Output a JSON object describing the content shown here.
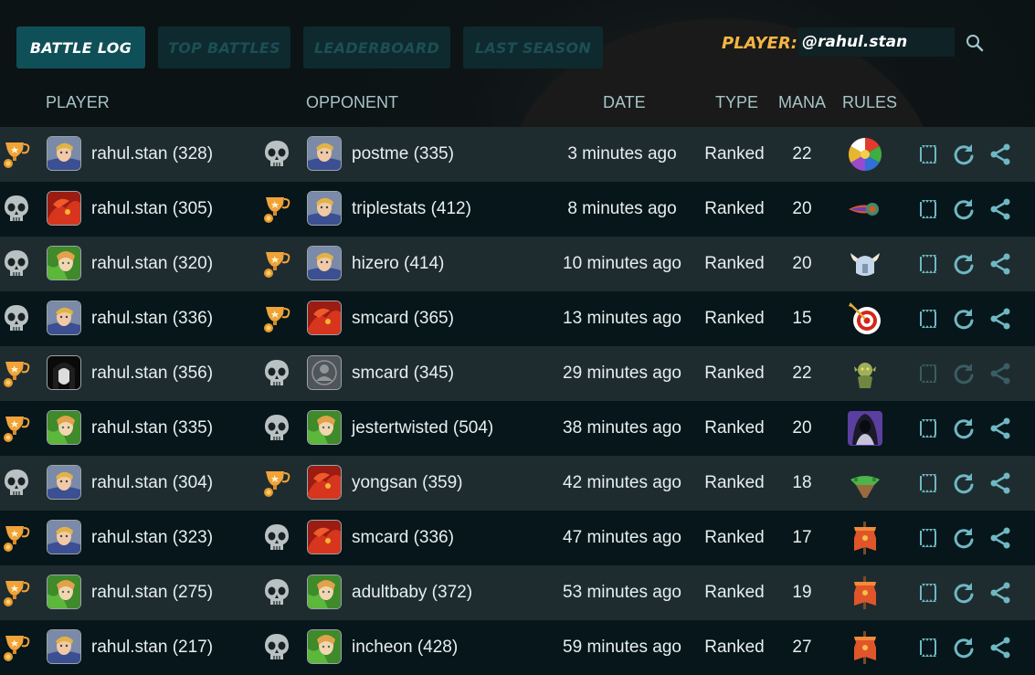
{
  "tabs": [
    {
      "label": "BATTLE LOG",
      "active": true
    },
    {
      "label": "TOP BATTLES",
      "active": false
    },
    {
      "label": "LEADERBOARD",
      "active": false
    },
    {
      "label": "LAST SEASON",
      "active": false
    }
  ],
  "player_search": {
    "label": "PLAYER:",
    "value": "@rahul.stan"
  },
  "columns": {
    "player": "PLAYER",
    "opponent": "OPPONENT",
    "date": "DATE",
    "type": "TYPE",
    "mana": "MANA",
    "rules": "RULES"
  },
  "colors": {
    "accent": "#0f4f58",
    "player_label": "#f3b544",
    "action_icons": "#6fb7c3"
  },
  "battles": [
    {
      "player_result": "win",
      "player": "rahul.stan (328)",
      "player_avatar": "blonde-hero",
      "opp_result": "loss",
      "opponent": "postme (335)",
      "opp_avatar": "blonde-hero",
      "date": "3 minutes ago",
      "type": "Ranked",
      "mana": "22",
      "rule_icon": "rainbow-splinters-icon",
      "actions_enabled": true
    },
    {
      "player_result": "loss",
      "player": "rahul.stan (305)",
      "player_avatar": "red-dragon",
      "opp_result": "win",
      "opponent": "triplestats (412)",
      "opp_avatar": "blonde-hero",
      "date": "8 minutes ago",
      "type": "Ranked",
      "mana": "20",
      "rule_icon": "comet-icon",
      "actions_enabled": true
    },
    {
      "player_result": "loss",
      "player": "rahul.stan (320)",
      "player_avatar": "forest-elf",
      "opp_result": "win",
      "opponent": "hizero (414)",
      "opp_avatar": "blonde-hero",
      "date": "10 minutes ago",
      "type": "Ranked",
      "mana": "20",
      "rule_icon": "horned-helmet-icon",
      "actions_enabled": true
    },
    {
      "player_result": "loss",
      "player": "rahul.stan (336)",
      "player_avatar": "blonde-hero",
      "opp_result": "win",
      "opponent": "smcard (365)",
      "opp_avatar": "red-dragon",
      "date": "13 minutes ago",
      "type": "Ranked",
      "mana": "15",
      "rule_icon": "target-icon",
      "actions_enabled": true
    },
    {
      "player_result": "win",
      "player": "rahul.stan (356)",
      "player_avatar": "dark-portrait",
      "opp_result": "loss",
      "opponent": "smcard (345)",
      "opp_avatar": "default-user",
      "date": "29 minutes ago",
      "type": "Ranked",
      "mana": "22",
      "rule_icon": "goblin-icon",
      "actions_enabled": false
    },
    {
      "player_result": "win",
      "player": "rahul.stan (335)",
      "player_avatar": "forest-elf",
      "opp_result": "loss",
      "opponent": "jestertwisted (504)",
      "opp_avatar": "forest-elf",
      "date": "38 minutes ago",
      "type": "Ranked",
      "mana": "20",
      "rule_icon": "hooded-figure-icon",
      "actions_enabled": true
    },
    {
      "player_result": "loss",
      "player": "rahul.stan (304)",
      "player_avatar": "blonde-hero",
      "opp_result": "win",
      "opponent": "yongsan (359)",
      "opp_avatar": "red-dragon",
      "date": "42 minutes ago",
      "type": "Ranked",
      "mana": "18",
      "rule_icon": "floating-island-icon",
      "actions_enabled": true
    },
    {
      "player_result": "win",
      "player": "rahul.stan (323)",
      "player_avatar": "blonde-hero",
      "opp_result": "loss",
      "opponent": "smcard (336)",
      "opp_avatar": "red-dragon",
      "date": "47 minutes ago",
      "type": "Ranked",
      "mana": "17",
      "rule_icon": "banner-icon",
      "actions_enabled": true
    },
    {
      "player_result": "win",
      "player": "rahul.stan (275)",
      "player_avatar": "forest-elf",
      "opp_result": "loss",
      "opponent": "adultbaby (372)",
      "opp_avatar": "forest-elf",
      "date": "53 minutes ago",
      "type": "Ranked",
      "mana": "19",
      "rule_icon": "banner-icon",
      "actions_enabled": true
    },
    {
      "player_result": "win",
      "player": "rahul.stan (217)",
      "player_avatar": "blonde-hero",
      "opp_result": "loss",
      "opponent": "incheon (428)",
      "opp_avatar": "forest-elf",
      "date": "59 minutes ago",
      "type": "Ranked",
      "mana": "27",
      "rule_icon": "banner-icon",
      "actions_enabled": true
    }
  ]
}
